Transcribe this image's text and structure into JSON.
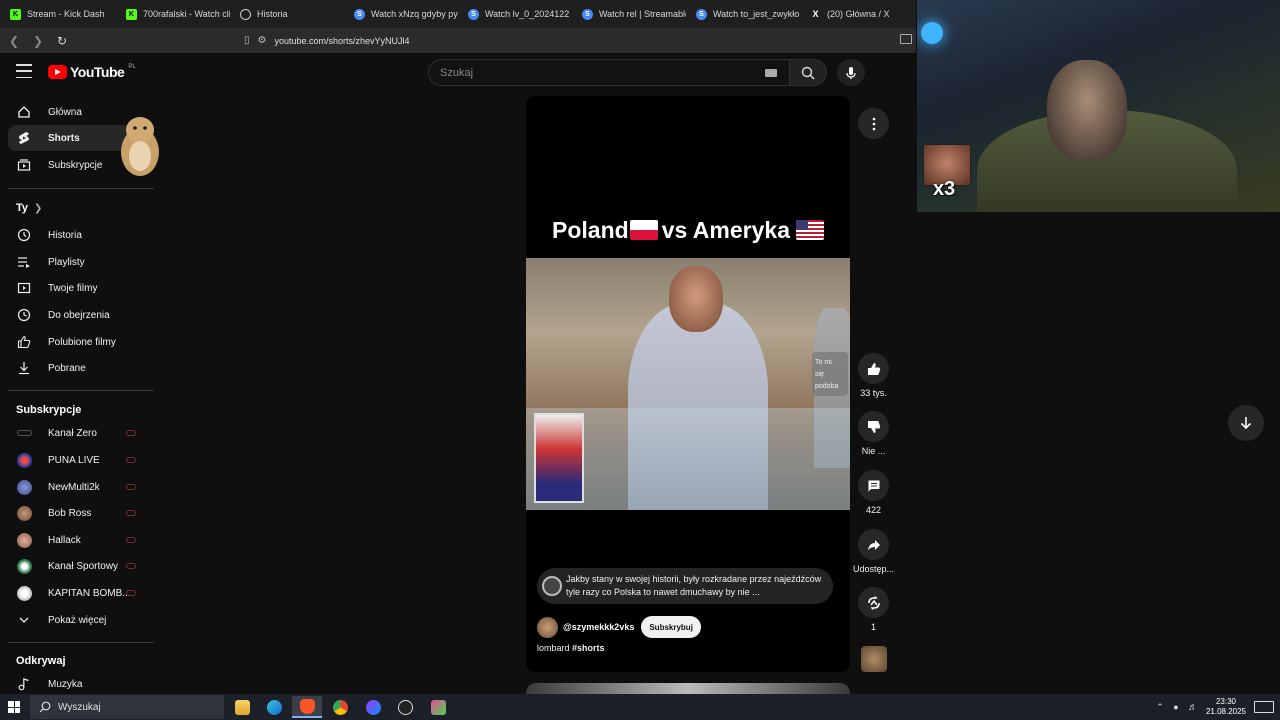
{
  "browser": {
    "tabs": [
      {
        "label": "Stream - Kick Dash",
        "icon": "kick-icon"
      },
      {
        "label": "700rafalski - Watch clip",
        "icon": "kick-icon"
      },
      {
        "label": "Historia",
        "icon": "history-icon"
      },
      {
        "label": "Watch xNzq gdyby pył",
        "icon": "streamable-icon"
      },
      {
        "label": "Watch lv_0_2024122",
        "icon": "streamable-icon"
      },
      {
        "label": "Watch rel | Streamable",
        "icon": "streamable-icon"
      },
      {
        "label": "Watch to_jest_zwykło",
        "icon": "streamable-icon"
      },
      {
        "label": "(20) Główna / X",
        "icon": "x-icon"
      }
    ],
    "url": "youtube.com/shorts/zhevYyNUJl4"
  },
  "header": {
    "logo_text": "YouTube",
    "country_code": "PL",
    "search_placeholder": "Szukaj"
  },
  "sidebar": {
    "main": [
      {
        "label": "Główna",
        "icon": "home-icon"
      },
      {
        "label": "Shorts",
        "icon": "shorts-icon",
        "active": true
      },
      {
        "label": "Subskrypcje",
        "icon": "subscriptions-icon"
      }
    ],
    "you_heading": "Ty",
    "you_items": [
      {
        "label": "Historia",
        "icon": "history-icon"
      },
      {
        "label": "Playlisty",
        "icon": "playlist-icon"
      },
      {
        "label": "Twoje filmy",
        "icon": "your-videos-icon"
      },
      {
        "label": "Do obejrzenia",
        "icon": "watch-later-icon"
      },
      {
        "label": "Polubione filmy",
        "icon": "liked-icon"
      },
      {
        "label": "Pobrane",
        "icon": "download-icon"
      }
    ],
    "subs_heading": "Subskrypcje",
    "subs": [
      {
        "label": "Kanał Zero",
        "avatar_color": "#222222"
      },
      {
        "label": "PUNA LIVE",
        "avatar_color": "#2c3e9a"
      },
      {
        "label": "NewMulti2k",
        "avatar_color": "#3a4a8a"
      },
      {
        "label": "Bob Ross",
        "avatar_color": "#6b4a3a"
      },
      {
        "label": "Hallack",
        "avatar_color": "#8a5a4a"
      },
      {
        "label": "Kanał Sportowy",
        "avatar_color": "#2f7a4a"
      },
      {
        "label": "KAPITAN BOMB...",
        "avatar_color": "#d8d8d8"
      }
    ],
    "show_more": "Pokaż więcej",
    "explore_heading": "Odkrywaj",
    "explore_items": [
      {
        "label": "Muzyka",
        "icon": "music-icon"
      }
    ]
  },
  "short": {
    "title_left": "Poland",
    "title_right": "vs Ameryka",
    "tooltip_lines": [
      "To mi",
      "się",
      "podoba"
    ],
    "description": "Jakby stany w swojej historii, były rozkradane przez najeźdźców tyle razy co Polska to nawet dmuchawy by nie ...",
    "channel": "@szymekkk2vks",
    "subscribe_label": "Subskrybuj",
    "caption_text": "lombard",
    "caption_tag": "#shorts"
  },
  "actions": {
    "likes": "33 tys.",
    "dislike": "Nie ...",
    "comments": "422",
    "share": "Udostęp...",
    "remix": "1"
  },
  "taskbar": {
    "search_label": "Wyszukaj",
    "time": "23:30",
    "date": "21.08.2025"
  },
  "webcam": {
    "emote_multiplier": "x3"
  }
}
